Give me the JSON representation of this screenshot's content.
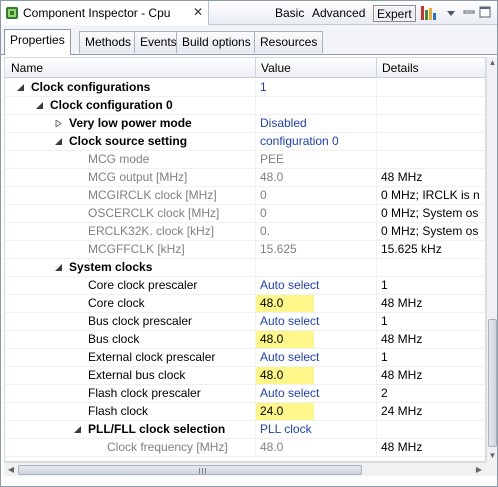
{
  "window": {
    "title": "Component Inspector - Cpu",
    "close_glyph": "✕",
    "modes": [
      "Basic",
      "Advanced",
      "Expert"
    ],
    "active_mode": "Expert"
  },
  "tabs": [
    "Properties",
    "Methods",
    "Events",
    "Build options",
    "Resources"
  ],
  "active_tab": "Properties",
  "columns": [
    "Name",
    "Value",
    "Details"
  ],
  "rows": [
    {
      "name": "Clock configurations",
      "value": "1",
      "details": "",
      "indent": 0,
      "expander": "expanded",
      "bold": true,
      "value_style": "blue",
      "highlight": false,
      "grey": false
    },
    {
      "name": "Clock configuration 0",
      "value": "",
      "details": "",
      "indent": 1,
      "expander": "expanded",
      "bold": true,
      "value_style": "",
      "highlight": false,
      "grey": false
    },
    {
      "name": "Very low power mode",
      "value": "Disabled",
      "details": "",
      "indent": 2,
      "expander": "collapsed",
      "bold": true,
      "value_style": "blue",
      "highlight": false,
      "grey": false
    },
    {
      "name": "Clock source setting",
      "value": "configuration 0",
      "details": "",
      "indent": 2,
      "expander": "expanded",
      "bold": true,
      "value_style": "blue",
      "highlight": false,
      "grey": false
    },
    {
      "name": "MCG mode",
      "value": "PEE",
      "details": "",
      "indent": 3,
      "expander": "none",
      "bold": false,
      "value_style": "grey",
      "highlight": false,
      "grey": true
    },
    {
      "name": "MCG output [MHz]",
      "value": "48.0",
      "details": "48 MHz",
      "indent": 3,
      "expander": "none",
      "bold": false,
      "value_style": "grey",
      "highlight": false,
      "grey": true
    },
    {
      "name": "MCGIRCLK clock [MHz]",
      "value": "0",
      "details": "0 MHz; IRCLK is n",
      "indent": 3,
      "expander": "none",
      "bold": false,
      "value_style": "grey",
      "highlight": false,
      "grey": true
    },
    {
      "name": "OSCERCLK clock [MHz]",
      "value": "0",
      "details": "0 MHz; System os",
      "indent": 3,
      "expander": "none",
      "bold": false,
      "value_style": "grey",
      "highlight": false,
      "grey": true
    },
    {
      "name": "ERCLK32K. clock [kHz]",
      "value": "0.",
      "details": "0 MHz; System os",
      "indent": 3,
      "expander": "none",
      "bold": false,
      "value_style": "grey",
      "highlight": false,
      "grey": true
    },
    {
      "name": "MCGFFCLK [kHz]",
      "value": "15.625",
      "details": "15.625 kHz",
      "indent": 3,
      "expander": "none",
      "bold": false,
      "value_style": "grey",
      "highlight": false,
      "grey": true
    },
    {
      "name": "System clocks",
      "value": "",
      "details": "",
      "indent": 2,
      "expander": "expanded",
      "bold": true,
      "value_style": "",
      "highlight": false,
      "grey": false
    },
    {
      "name": "Core clock prescaler",
      "value": "Auto select",
      "details": "1",
      "indent": 3,
      "expander": "none",
      "bold": false,
      "value_style": "blue",
      "highlight": false,
      "grey": false
    },
    {
      "name": "Core clock",
      "value": "48.0",
      "details": "48 MHz",
      "indent": 3,
      "expander": "none",
      "bold": false,
      "value_style": "",
      "highlight": true,
      "grey": false
    },
    {
      "name": "Bus clock prescaler",
      "value": "Auto select",
      "details": "1",
      "indent": 3,
      "expander": "none",
      "bold": false,
      "value_style": "blue",
      "highlight": false,
      "grey": false
    },
    {
      "name": "Bus clock",
      "value": "48.0",
      "details": "48 MHz",
      "indent": 3,
      "expander": "none",
      "bold": false,
      "value_style": "",
      "highlight": true,
      "grey": false
    },
    {
      "name": "External clock prescaler",
      "value": "Auto select",
      "details": "1",
      "indent": 3,
      "expander": "none",
      "bold": false,
      "value_style": "blue",
      "highlight": false,
      "grey": false
    },
    {
      "name": "External bus clock",
      "value": "48.0",
      "details": "48 MHz",
      "indent": 3,
      "expander": "none",
      "bold": false,
      "value_style": "",
      "highlight": true,
      "grey": false
    },
    {
      "name": "Flash clock prescaler",
      "value": "Auto select",
      "details": "2",
      "indent": 3,
      "expander": "none",
      "bold": false,
      "value_style": "blue",
      "highlight": false,
      "grey": false
    },
    {
      "name": "Flash clock",
      "value": "24.0",
      "details": "24 MHz",
      "indent": 3,
      "expander": "none",
      "bold": false,
      "value_style": "",
      "highlight": true,
      "grey": false
    },
    {
      "name": "PLL/FLL clock selection",
      "value": "PLL clock",
      "details": "",
      "indent": 3,
      "expander": "expanded",
      "bold": true,
      "value_style": "blue",
      "highlight": false,
      "grey": false
    },
    {
      "name": "Clock frequency [MHz]",
      "value": "48.0",
      "details": "48 MHz",
      "indent": 4,
      "expander": "none",
      "bold": false,
      "value_style": "grey",
      "highlight": false,
      "grey": true
    }
  ],
  "colors": {
    "accent_blue": "#1f3fb8",
    "highlight_yellow": "#fdf78a",
    "grey_text": "#808080"
  }
}
